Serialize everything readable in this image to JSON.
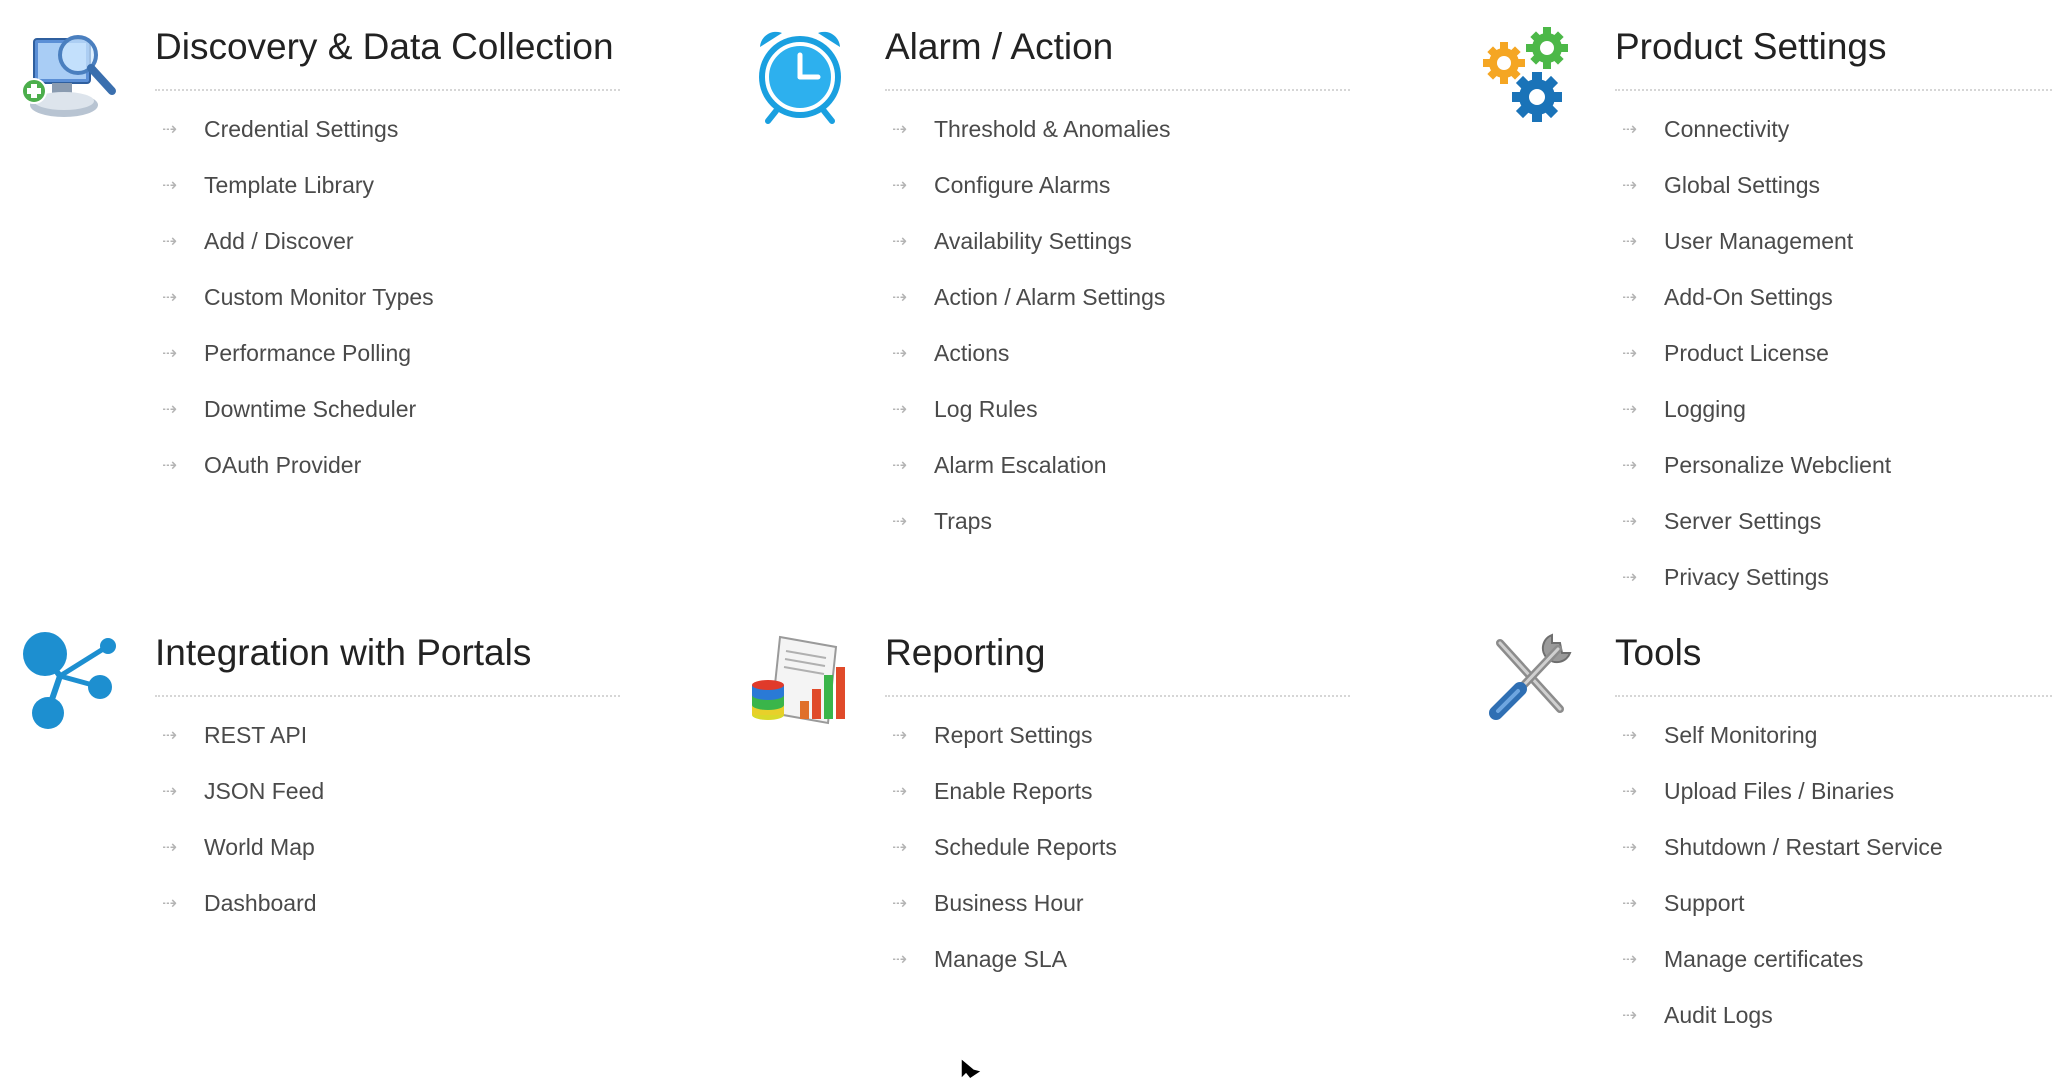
{
  "sections": [
    {
      "title": "Discovery & Data Collection",
      "icon": "discovery-monitor-icon",
      "items": [
        {
          "label": "Credential Settings"
        },
        {
          "label": "Template Library"
        },
        {
          "label": "Add / Discover"
        },
        {
          "label": "Custom Monitor Types"
        },
        {
          "label": "Performance Polling"
        },
        {
          "label": "Downtime Scheduler"
        },
        {
          "label": "OAuth Provider"
        }
      ]
    },
    {
      "title": "Alarm / Action",
      "icon": "alarm-clock-icon",
      "items": [
        {
          "label": "Threshold & Anomalies"
        },
        {
          "label": "Configure Alarms"
        },
        {
          "label": "Availability Settings"
        },
        {
          "label": "Action / Alarm Settings"
        },
        {
          "label": "Actions"
        },
        {
          "label": "Log Rules"
        },
        {
          "label": "Alarm Escalation"
        },
        {
          "label": "Traps"
        }
      ]
    },
    {
      "title": "Product Settings",
      "icon": "gears-icon",
      "items": [
        {
          "label": "Connectivity"
        },
        {
          "label": "Global Settings"
        },
        {
          "label": "User Management"
        },
        {
          "label": "Add-On Settings"
        },
        {
          "label": "Product License"
        },
        {
          "label": "Logging"
        },
        {
          "label": "Personalize Webclient"
        },
        {
          "label": "Server Settings"
        },
        {
          "label": "Privacy Settings"
        }
      ]
    },
    {
      "title": "Integration with Portals",
      "icon": "network-nodes-icon",
      "items": [
        {
          "label": "REST API"
        },
        {
          "label": "JSON Feed"
        },
        {
          "label": "World Map"
        },
        {
          "label": "Dashboard"
        }
      ]
    },
    {
      "title": "Reporting",
      "icon": "report-chart-icon",
      "items": [
        {
          "label": "Report Settings"
        },
        {
          "label": "Enable Reports"
        },
        {
          "label": "Schedule Reports"
        },
        {
          "label": "Business Hour"
        },
        {
          "label": "Manage SLA"
        }
      ]
    },
    {
      "title": "Tools",
      "icon": "wrench-screwdriver-icon",
      "items": [
        {
          "label": "Self Monitoring"
        },
        {
          "label": "Upload Files / Binaries"
        },
        {
          "label": "Shutdown / Restart Service"
        },
        {
          "label": "Support"
        },
        {
          "label": "Manage certificates"
        },
        {
          "label": "Audit Logs"
        }
      ]
    }
  ],
  "item_arrow": "arrow-right-icon",
  "colors": {
    "title": "#222222",
    "item_text": "#4a4a4a",
    "arrow": "#b4b4b4",
    "divider": "#d6d6d6",
    "alarm_blue": "#1aa0e0",
    "gear_orange": "#f5a623",
    "gear_green": "#4cb848",
    "gear_blue": "#1a73b8",
    "integration_blue": "#1d8fd0"
  }
}
